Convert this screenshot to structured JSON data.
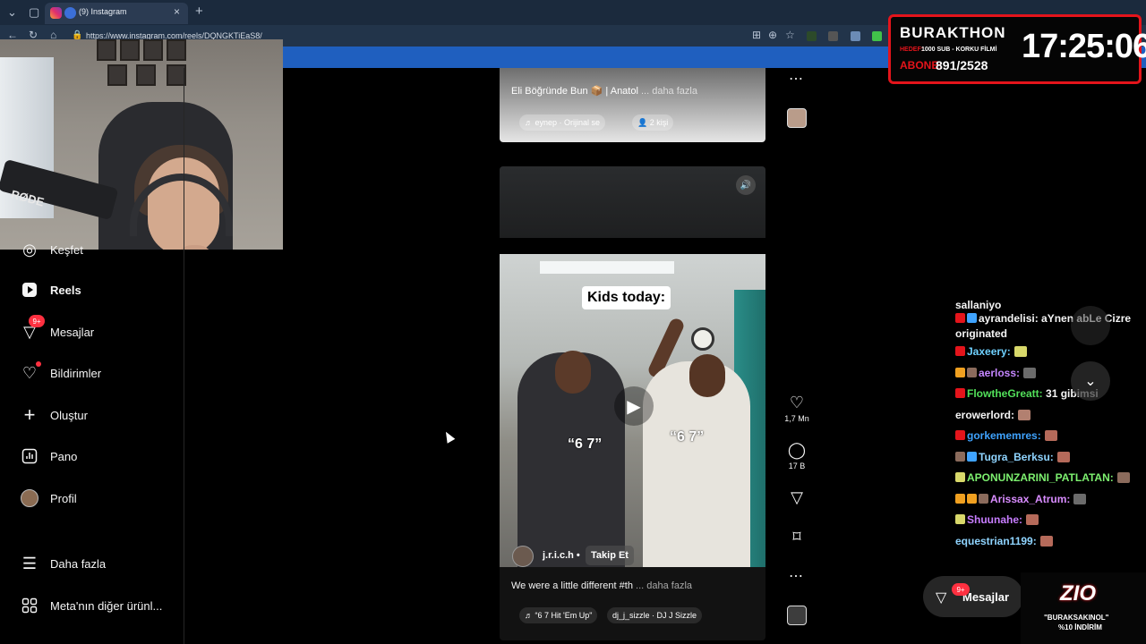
{
  "browser": {
    "tab_title": "(9) Instagram",
    "tab_close": "×",
    "new_tab": "+",
    "url": "https://www.instagram.com/reels/DQNGKTiEaS8/"
  },
  "webcam": {
    "mic_brand": "RØDE"
  },
  "sidebar": {
    "items": [
      {
        "label": "Keşfet",
        "icon": "compass-icon"
      },
      {
        "label": "Reels",
        "icon": "reels-icon"
      },
      {
        "label": "Mesajlar",
        "icon": "messenger-icon",
        "badge": "9+"
      },
      {
        "label": "Bildirimler",
        "icon": "heart-icon"
      },
      {
        "label": "Oluştur",
        "icon": "plus-icon"
      },
      {
        "label": "Pano",
        "icon": "dashboard-icon"
      },
      {
        "label": "Profil",
        "icon": "avatar-icon"
      },
      {
        "label": "Daha fazla",
        "icon": "menu-icon"
      },
      {
        "label": "Meta'nın diğer ürünl...",
        "icon": "meta-apps-icon"
      }
    ]
  },
  "post1": {
    "description": "Eli Böğründe Bun 📦 | Anatol",
    "more": "... daha fazla",
    "music": "♬ eynep · Orijinal se",
    "people": "👤 2 kişi"
  },
  "reel": {
    "caption": "Kids today:",
    "shirt_left": "“6 7”",
    "shirt_right": "“6 7”",
    "author": "j.r.i.c.h •",
    "follow": "Takip Et",
    "description": "We were a little different #th",
    "more": "... daha fazla",
    "music": "♬ “6 7 Hit 'Em Up\"",
    "artist": "dj_j_sizzle · DJ J Sizzle"
  },
  "actions": {
    "likes": "1,7 Mn",
    "comments": "17 B"
  },
  "stream": {
    "title": "BURAKTHON",
    "goal_label": "HEDEF:",
    "goal": "1000 SUB - KORKU FİLMİ",
    "sub_label": "ABONE:",
    "sub_count": "891/2528",
    "clock": "17:25:06"
  },
  "chat": [
    {
      "user": "sallaniyo",
      "msg": "",
      "color": "#ffffff"
    },
    {
      "user": "ayrandelisi:",
      "msg": "aYnen abLe Cizre",
      "color": "#ffffff"
    },
    {
      "user": "originated",
      "msg": "",
      "color": "#ffffff"
    },
    {
      "user": "Jaxeery:",
      "msg": "",
      "color": "#6fd1ff"
    },
    {
      "user": "aerloss:",
      "msg": "",
      "color": "#c586ff"
    },
    {
      "user": "FlowtheGreatt:",
      "msg": "31 gibimsi",
      "color": "#52e05a"
    },
    {
      "user": "erowerlord:",
      "msg": "",
      "color": "#ffffff"
    },
    {
      "user": "gorkememres:",
      "msg": "",
      "color": "#3fa3ff"
    },
    {
      "user": "Tugra_Berksu:",
      "msg": "",
      "color": "#8fd4ff"
    },
    {
      "user": "APONUNZARINI_PATLATAN:",
      "msg": "",
      "color": "#7df06f"
    },
    {
      "user": "Arissax_Atrum:",
      "msg": "",
      "color": "#d98cff"
    },
    {
      "user": "Shuunahe:",
      "msg": "",
      "color": "#c77dff"
    },
    {
      "user": "equestrian1199:",
      "msg": "",
      "color": "#8fd4ff"
    }
  ],
  "messages_pill": {
    "label": "Mesajlar",
    "badge": "9+"
  },
  "sponsor": {
    "logo": "ZIO",
    "line1": "\"BURAKSAKINOL\"",
    "line2": "%10 İNDİRİM"
  },
  "colors": {
    "accent_red": "#e4141b",
    "notification_red": "#ff3040",
    "tab_bar": "#1b2a3d"
  }
}
